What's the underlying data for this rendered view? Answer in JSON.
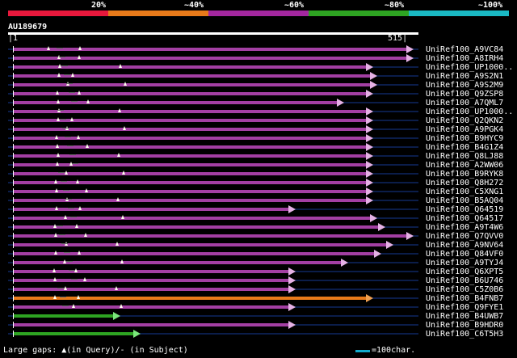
{
  "legend": {
    "labels": [
      "20%",
      "~40%",
      "~60%",
      "~80%",
      "~100%"
    ],
    "colors": [
      "#e8183c",
      "#e87a1a",
      "#a3279f",
      "#2ea422",
      "#1ab9c4"
    ]
  },
  "query": {
    "name": "AU189679",
    "start": "1",
    "end": "515"
  },
  "hits": [
    {
      "label": "UniRef100_A9VC84",
      "color": "#a33fa3",
      "length_pct": 0.98
    },
    {
      "label": "UniRef100_A8IRH4",
      "color": "#a33fa3",
      "length_pct": 0.98
    },
    {
      "label": "UniRef100_UP1000..",
      "color": "#a33fa3",
      "length_pct": 0.88
    },
    {
      "label": "UniRef100_A9S2N1",
      "color": "#a33fa3",
      "length_pct": 0.89
    },
    {
      "label": "UniRef100_A9S2M9",
      "color": "#a33fa3",
      "length_pct": 0.89
    },
    {
      "label": "UniRef100_Q9ZSP8",
      "color": "#a33fa3",
      "length_pct": 0.88
    },
    {
      "label": "UniRef100_A7QML7",
      "color": "#a33fa3",
      "length_pct": 0.81
    },
    {
      "label": "UniRef100_UP1000..",
      "color": "#a33fa3",
      "length_pct": 0.88
    },
    {
      "label": "UniRef100_Q2QKN2",
      "color": "#a33fa3",
      "length_pct": 0.88
    },
    {
      "label": "UniRef100_A9PGK4",
      "color": "#a33fa3",
      "length_pct": 0.88
    },
    {
      "label": "UniRef100_B9HYC9",
      "color": "#a33fa3",
      "length_pct": 0.88
    },
    {
      "label": "UniRef100_B4G1Z4",
      "color": "#a33fa3",
      "length_pct": 0.88
    },
    {
      "label": "UniRef100_Q8LJ88",
      "color": "#a33fa3",
      "length_pct": 0.88
    },
    {
      "label": "UniRef100_A2WW06",
      "color": "#a33fa3",
      "length_pct": 0.88
    },
    {
      "label": "UniRef100_B9RYK8",
      "color": "#a33fa3",
      "length_pct": 0.88
    },
    {
      "label": "UniRef100_Q8H272",
      "color": "#a33fa3",
      "length_pct": 0.88
    },
    {
      "label": "UniRef100_C5XNG1",
      "color": "#a33fa3",
      "length_pct": 0.88
    },
    {
      "label": "UniRef100_B5AQ04",
      "color": "#a33fa3",
      "length_pct": 0.88
    },
    {
      "label": "UniRef100_Q64519",
      "color": "#a33fa3",
      "length_pct": 0.69
    },
    {
      "label": "UniRef100_Q64517",
      "color": "#a33fa3",
      "length_pct": 0.89
    },
    {
      "label": "UniRef100_A9T4W6",
      "color": "#a33fa3",
      "length_pct": 0.91
    },
    {
      "label": "UniRef100_Q7QVV0",
      "color": "#a33fa3",
      "length_pct": 0.98
    },
    {
      "label": "UniRef100_A9NV64",
      "color": "#a33fa3",
      "length_pct": 0.93
    },
    {
      "label": "UniRef100_Q84VF0",
      "color": "#a33fa3",
      "length_pct": 0.9
    },
    {
      "label": "UniRef100_A9TYJ4",
      "color": "#a33fa3",
      "length_pct": 0.82
    },
    {
      "label": "UniRef100_Q6XPT5",
      "color": "#a33fa3",
      "length_pct": 0.69
    },
    {
      "label": "UniRef100_B6U746",
      "color": "#a33fa3",
      "length_pct": 0.69
    },
    {
      "label": "UniRef100_C5Z0B6",
      "color": "#a33fa3",
      "length_pct": 0.69
    },
    {
      "label": "UniRef100_B4FNB7",
      "color": "#e87a1a",
      "length_pct": 0.88
    },
    {
      "label": "UniRef100_Q9FYE1",
      "color": "#a33fa3",
      "length_pct": 0.69
    },
    {
      "label": "UniRef100_B4UWB7",
      "color": "#2ea422",
      "length_pct": 0.26
    },
    {
      "label": "UniRef100_B9HDR0",
      "color": "#a33fa3",
      "length_pct": 0.69
    },
    {
      "label": "UniRef100_C6T5H3",
      "color": "#2ea422",
      "length_pct": 0.31
    }
  ],
  "footer": {
    "gaps_label": "Large gaps: ▲(in Query)/- (in Subject)",
    "scale_label": "=100char."
  }
}
